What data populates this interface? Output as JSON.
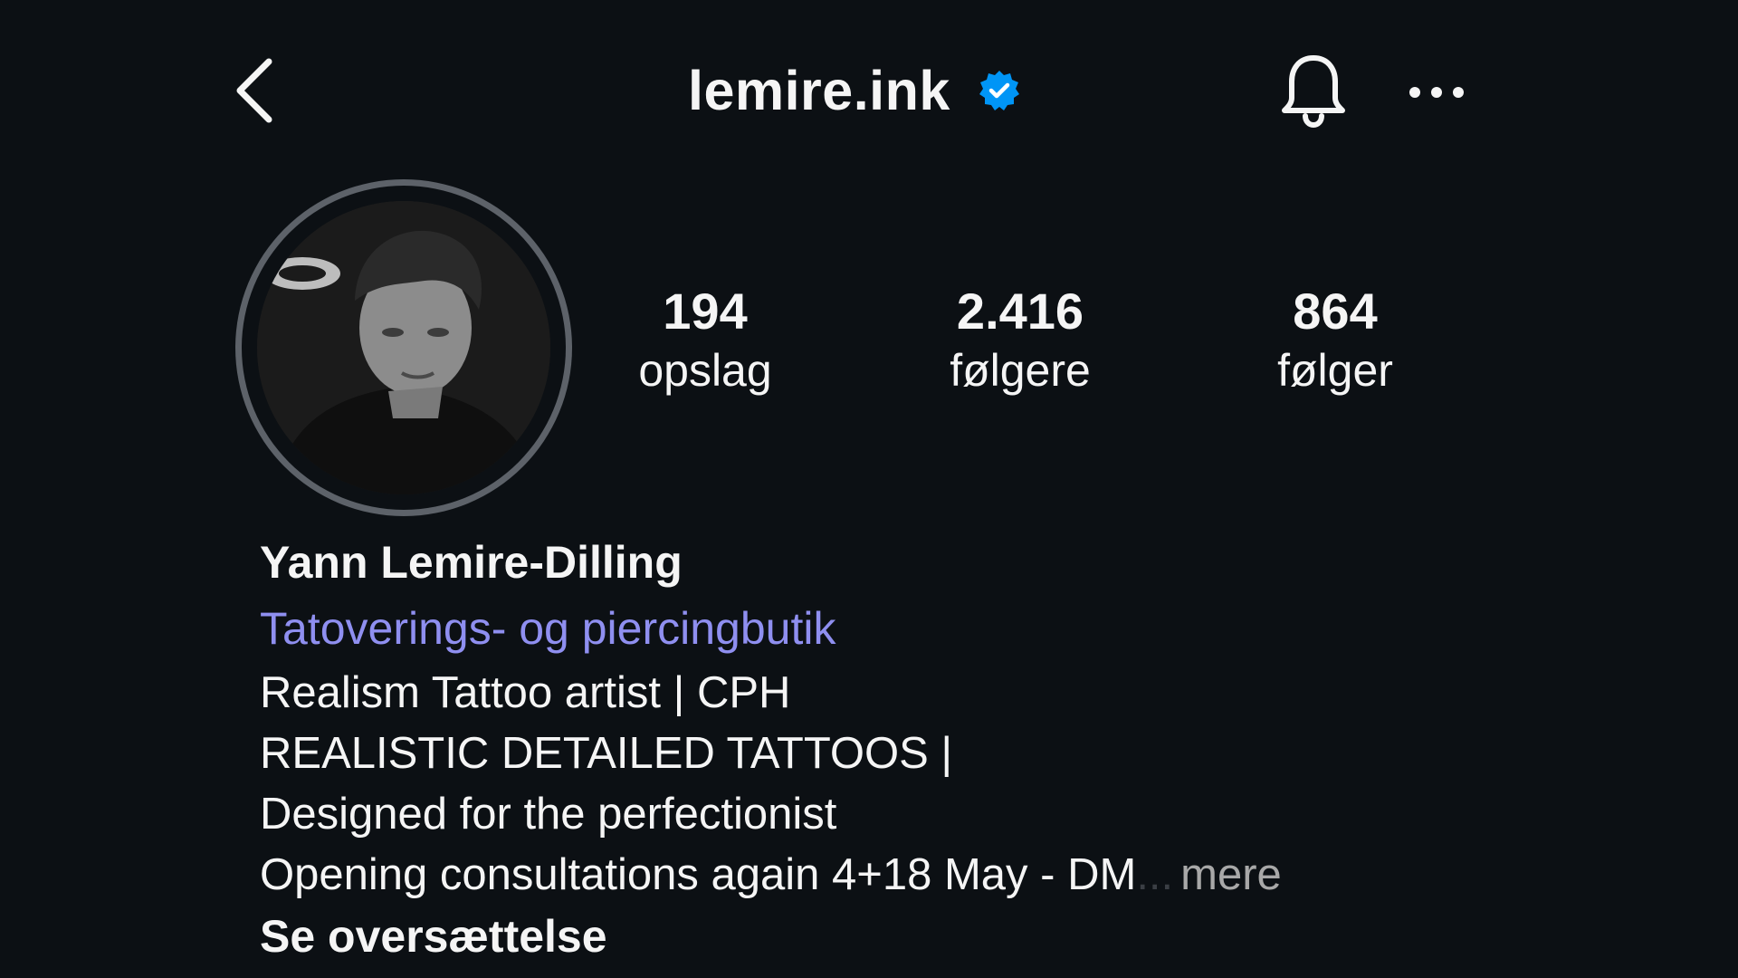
{
  "header": {
    "back_icon": "chevron-left-icon",
    "username": "lemire.ink",
    "verified_icon": "verified-badge-icon",
    "notifications_icon": "bell-icon",
    "more_icon": "more-horizontal-icon"
  },
  "profile": {
    "avatar_icon": "profile-photo",
    "stats": [
      {
        "count": "194",
        "label": "opslag"
      },
      {
        "count": "2.416",
        "label": "følgere"
      },
      {
        "count": "864",
        "label": "følger"
      }
    ]
  },
  "bio": {
    "display_name": "Yann Lemire-Dilling",
    "category": "Tatoverings- og piercingbutik",
    "lines": [
      "Realism Tattoo artist | CPH",
      "REALISTIC DETAILED TATTOOS |",
      "Designed for the perfectionist",
      "Opening consultations again 4+18 May - DM"
    ],
    "ellipsis": "...",
    "more_label": "mere",
    "translate_label": "Se oversættelse"
  },
  "colors": {
    "background": "#0c1014",
    "text": "#f5f5f5",
    "category_link": "#8f8ff0",
    "verified": "#0095f6",
    "muted": "#a8a8a8"
  }
}
